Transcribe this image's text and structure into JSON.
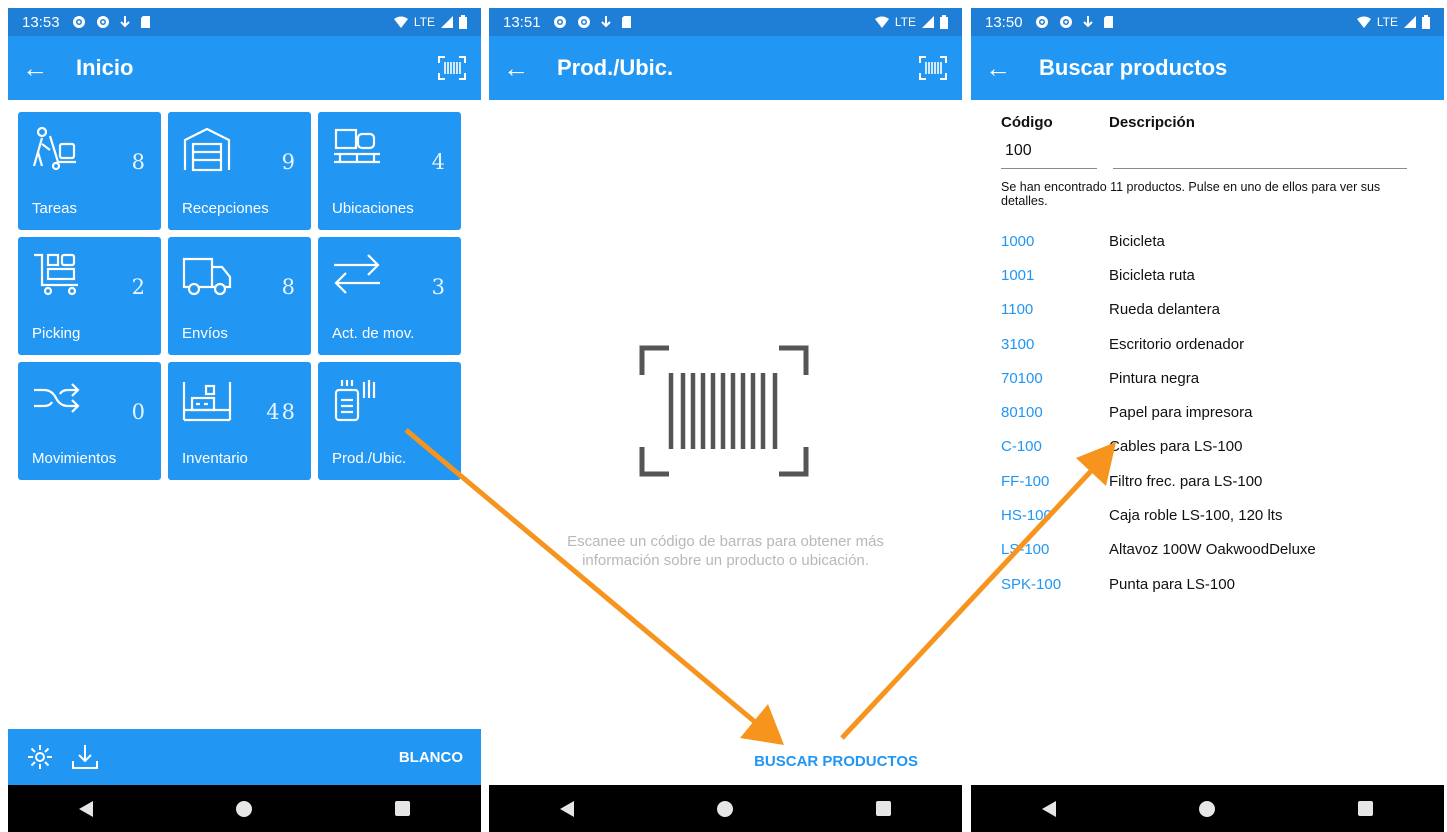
{
  "colors": {
    "primary": "#2196f3",
    "status_bar": "#1f7fd6",
    "arrow": "#f7941d",
    "hint": "#b8b8b8"
  },
  "screen1": {
    "status": {
      "time": "13:53",
      "network": "LTE"
    },
    "title": "Inicio",
    "tiles": [
      {
        "icon": "dolly-icon",
        "count": "8",
        "label": "Tareas"
      },
      {
        "icon": "warehouse-icon",
        "count": "9",
        "label": "Recepciones"
      },
      {
        "icon": "pallet-boxes-icon",
        "count": "4",
        "label": "Ubicaciones"
      },
      {
        "icon": "picking-cart-icon",
        "count": "2",
        "label": "Picking"
      },
      {
        "icon": "truck-icon",
        "count": "8",
        "label": "Envíos"
      },
      {
        "icon": "swap-arrows-icon",
        "count": "3",
        "label": "Act. de mov."
      },
      {
        "icon": "shuffle-icon",
        "count": "0",
        "label": "Movimientos"
      },
      {
        "icon": "shelf-icon",
        "count": "48",
        "label": "Inventario"
      },
      {
        "icon": "scanner-device-icon",
        "count": "",
        "label": "Prod./Ubic."
      }
    ],
    "bottom": {
      "label": "BLANCO"
    }
  },
  "screen2": {
    "status": {
      "time": "13:51",
      "network": "LTE"
    },
    "title": "Prod./Ubic.",
    "hint": "Escanee un código de barras para obtener más información sobre un producto o ubicación.",
    "button": "BUSCAR PRODUCTOS"
  },
  "screen3": {
    "status": {
      "time": "13:50",
      "network": "LTE"
    },
    "title": "Buscar productos",
    "code_label": "Código",
    "desc_label": "Descripción",
    "code_value": "100",
    "desc_value": "",
    "info": "Se han encontrado 11 productos. Pulse en uno de ellos para ver sus detalles.",
    "products": [
      {
        "code": "1000",
        "desc": "Bicicleta"
      },
      {
        "code": "1001",
        "desc": "Bicicleta ruta"
      },
      {
        "code": "1100",
        "desc": "Rueda delantera"
      },
      {
        "code": "3100",
        "desc": "Escritorio ordenador"
      },
      {
        "code": "70100",
        "desc": "Pintura negra"
      },
      {
        "code": "80100",
        "desc": "Papel para impresora"
      },
      {
        "code": "C-100",
        "desc": "Cables para LS-100"
      },
      {
        "code": "FF-100",
        "desc": "Filtro frec. para LS-100"
      },
      {
        "code": "HS-100",
        "desc": "Caja roble LS-100, 120 lts"
      },
      {
        "code": "LS-100",
        "desc": "Altavoz 100W OakwoodDeluxe"
      },
      {
        "code": "SPK-100",
        "desc": "Punta para LS-100"
      }
    ]
  }
}
